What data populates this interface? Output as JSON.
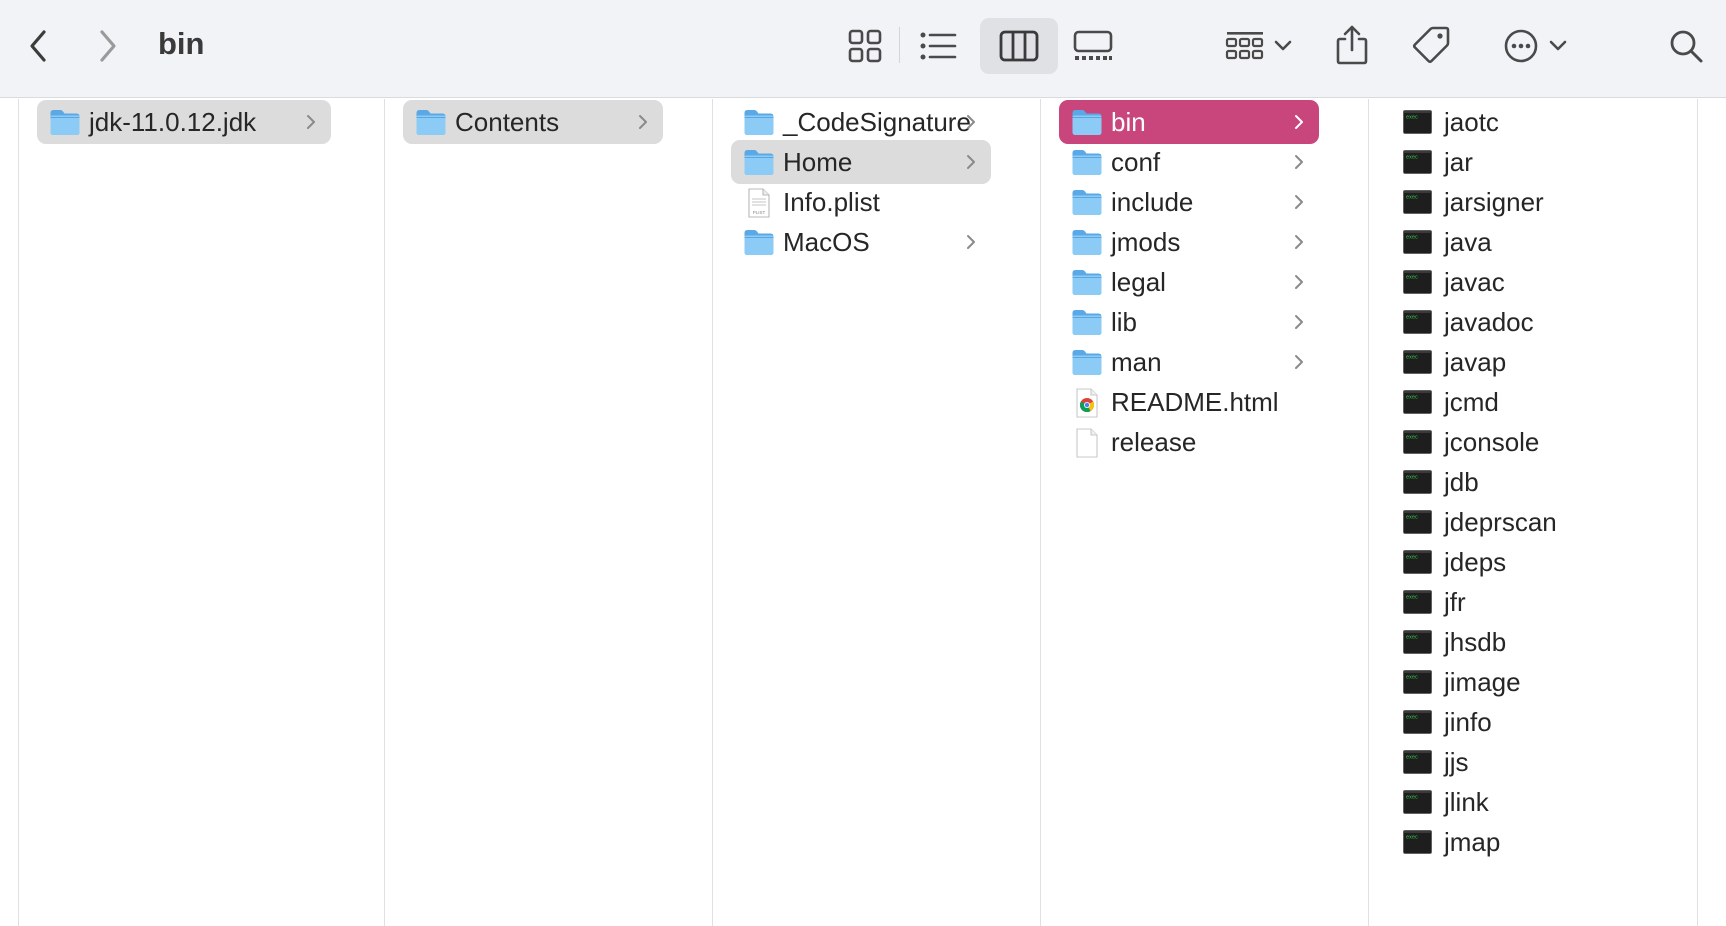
{
  "window": {
    "title": "bin"
  },
  "toolbar": {
    "back": {
      "icon": "chevron-left-icon"
    },
    "forward": {
      "icon": "chevron-right-icon"
    },
    "views": [
      {
        "name": "icon-view",
        "icon": "grid-icon",
        "active": false
      },
      {
        "name": "list-view",
        "icon": "list-icon",
        "active": false
      },
      {
        "name": "column-view",
        "icon": "columns-icon",
        "active": true
      },
      {
        "name": "gallery-view",
        "icon": "gallery-icon",
        "active": false
      }
    ],
    "group": {
      "icon": "group-icon"
    },
    "share": {
      "icon": "share-icon"
    },
    "tags": {
      "icon": "tag-icon"
    },
    "more": {
      "icon": "ellipsis-circle-icon"
    },
    "search": {
      "icon": "search-icon"
    }
  },
  "columns": [
    {
      "items": [
        {
          "label": "jdk-11.0.12.jdk",
          "kind": "folder",
          "has_children": true,
          "selected": "grey"
        }
      ]
    },
    {
      "items": [
        {
          "label": "Contents",
          "kind": "folder",
          "has_children": true,
          "selected": "grey"
        }
      ]
    },
    {
      "items": [
        {
          "label": "_CodeSignature",
          "kind": "folder",
          "has_children": true,
          "selected": ""
        },
        {
          "label": "Home",
          "kind": "folder",
          "has_children": true,
          "selected": "grey"
        },
        {
          "label": "Info.plist",
          "kind": "plist",
          "has_children": false,
          "selected": ""
        },
        {
          "label": "MacOS",
          "kind": "folder",
          "has_children": true,
          "selected": ""
        }
      ]
    },
    {
      "items": [
        {
          "label": "bin",
          "kind": "folder",
          "has_children": true,
          "selected": "pink"
        },
        {
          "label": "conf",
          "kind": "folder",
          "has_children": true,
          "selected": ""
        },
        {
          "label": "include",
          "kind": "folder",
          "has_children": true,
          "selected": ""
        },
        {
          "label": "jmods",
          "kind": "folder",
          "has_children": true,
          "selected": ""
        },
        {
          "label": "legal",
          "kind": "folder",
          "has_children": true,
          "selected": ""
        },
        {
          "label": "lib",
          "kind": "folder",
          "has_children": true,
          "selected": ""
        },
        {
          "label": "man",
          "kind": "folder",
          "has_children": true,
          "selected": ""
        },
        {
          "label": "README.html",
          "kind": "html",
          "has_children": false,
          "selected": ""
        },
        {
          "label": "release",
          "kind": "file",
          "has_children": false,
          "selected": ""
        }
      ]
    },
    {
      "items": [
        {
          "label": "jaotc",
          "kind": "exec"
        },
        {
          "label": "jar",
          "kind": "exec"
        },
        {
          "label": "jarsigner",
          "kind": "exec"
        },
        {
          "label": "java",
          "kind": "exec"
        },
        {
          "label": "javac",
          "kind": "exec"
        },
        {
          "label": "javadoc",
          "kind": "exec"
        },
        {
          "label": "javap",
          "kind": "exec"
        },
        {
          "label": "jcmd",
          "kind": "exec"
        },
        {
          "label": "jconsole",
          "kind": "exec"
        },
        {
          "label": "jdb",
          "kind": "exec"
        },
        {
          "label": "jdeprscan",
          "kind": "exec"
        },
        {
          "label": "jdeps",
          "kind": "exec"
        },
        {
          "label": "jfr",
          "kind": "exec"
        },
        {
          "label": "jhsdb",
          "kind": "exec"
        },
        {
          "label": "jimage",
          "kind": "exec"
        },
        {
          "label": "jinfo",
          "kind": "exec"
        },
        {
          "label": "jjs",
          "kind": "exec"
        },
        {
          "label": "jlink",
          "kind": "exec"
        },
        {
          "label": "jmap",
          "kind": "exec"
        }
      ]
    }
  ],
  "colors": {
    "selection_active": "#c8467c",
    "selection_inactive": "#dcdcdc",
    "folder": "#6cb4ea",
    "toolbar_bg": "#f1f3f6"
  }
}
